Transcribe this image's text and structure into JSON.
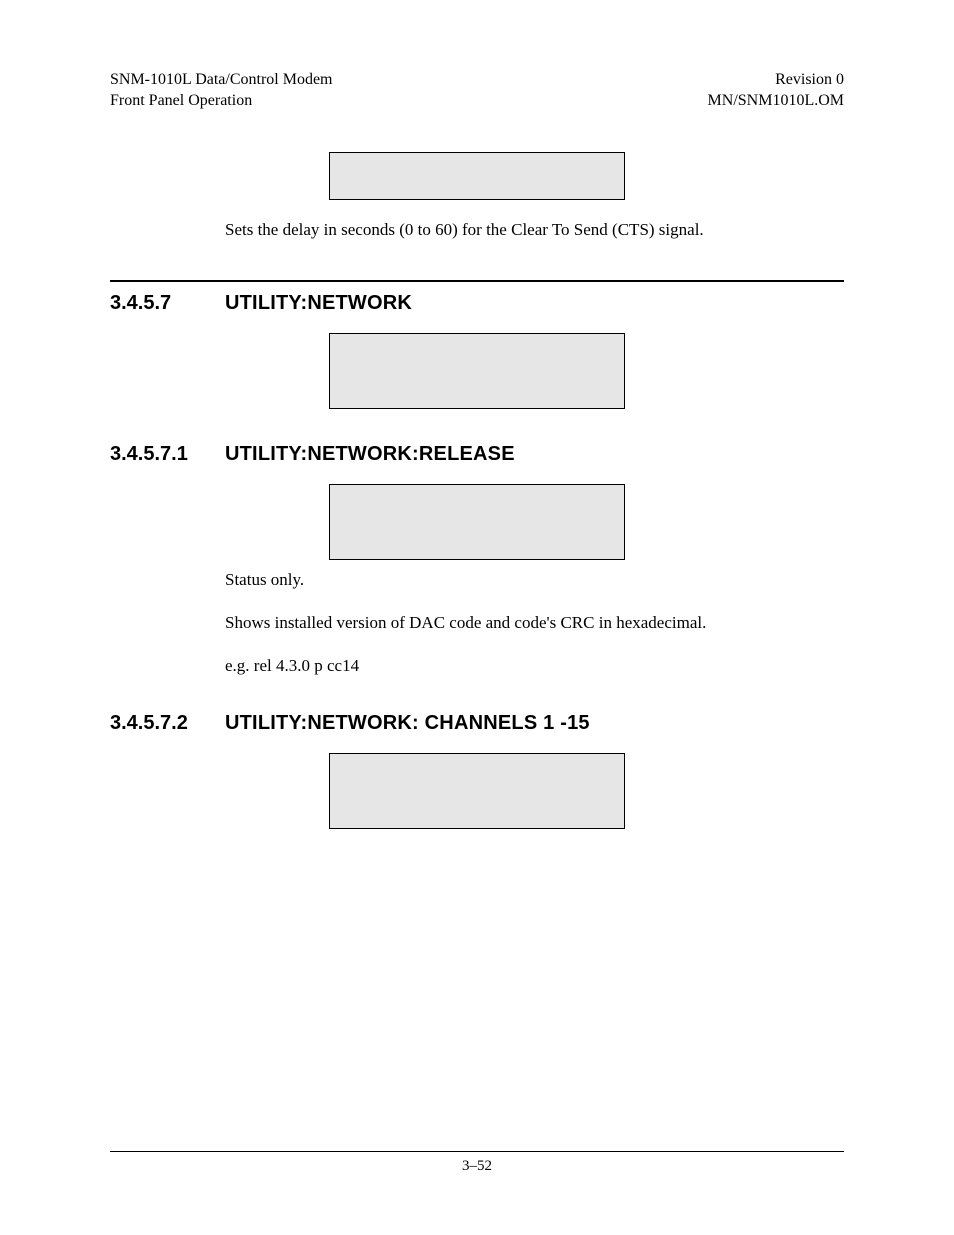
{
  "header": {
    "left1": "SNM-1010L Data/Control Modem",
    "left2": "Front Panel Operation",
    "right1": "Revision 0",
    "right2": "MN/SNM1010L.OM"
  },
  "intro": {
    "para1": "Sets the delay in seconds (0 to 60) for the Clear To Send (CTS) signal."
  },
  "sec347": {
    "num": "3.4.5.7",
    "title": "UTILITY:NETWORK"
  },
  "sec3471": {
    "num": "3.4.5.7.1",
    "title": "UTILITY:NETWORK:RELEASE",
    "p1": "Status only.",
    "p2": "Shows installed version of DAC code and code's CRC in hexadecimal.",
    "p3": "e.g. rel 4.3.0 p cc14"
  },
  "sec3472": {
    "num": "3.4.5.7.2",
    "title": "UTILITY:NETWORK: CHANNELS 1 -15"
  },
  "footer": {
    "pagenum": "3–52"
  }
}
